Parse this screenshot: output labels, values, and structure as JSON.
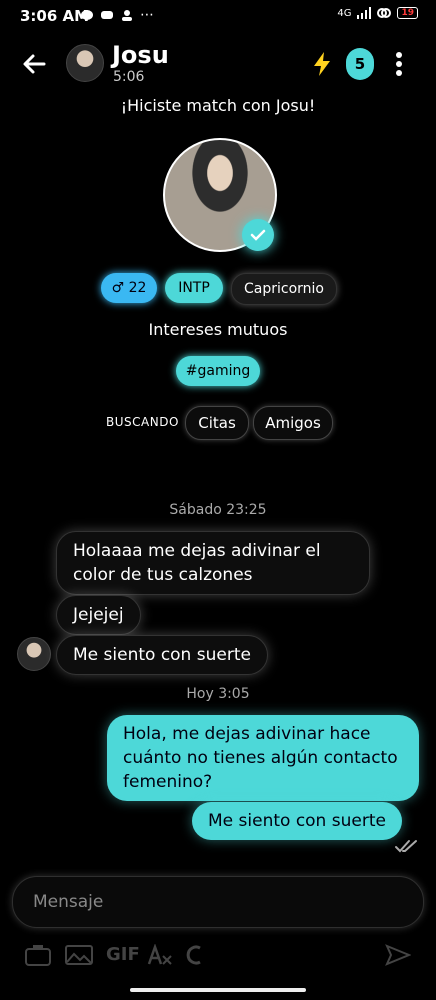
{
  "status_bar": {
    "time": "3:06 AM",
    "network": "4G",
    "battery": "19"
  },
  "header": {
    "name": "Josu",
    "subtitle": "5:06",
    "badge_count": "5"
  },
  "match_title": "¡Hiciste match con Josu!",
  "profile": {
    "chips": {
      "age": "♂ 22",
      "mbti": "INTP",
      "zodiac": "Capricornio"
    },
    "interests_title": "Intereses mutuos",
    "interests": [
      "#gaming"
    ],
    "looking_label": "BUSCANDO",
    "looking": [
      "Citas",
      "Amigos"
    ]
  },
  "chat": {
    "date_1": "Sábado 23:25",
    "incoming": [
      "Holaaaa me dejas adivinar el color de tus calzones",
      "Jejejej",
      "Me siento con suerte"
    ],
    "date_2": "Hoy 3:05",
    "outgoing": [
      "Hola, me dejas adivinar hace cuánto no tienes algún contacto femenino?",
      "Me siento con suerte"
    ]
  },
  "composer": {
    "placeholder": "Mensaje",
    "gif_label": "GIF"
  },
  "colors": {
    "accent": "#4dd8d8",
    "age_chip": "#3ab8f2",
    "background": "#000000"
  }
}
